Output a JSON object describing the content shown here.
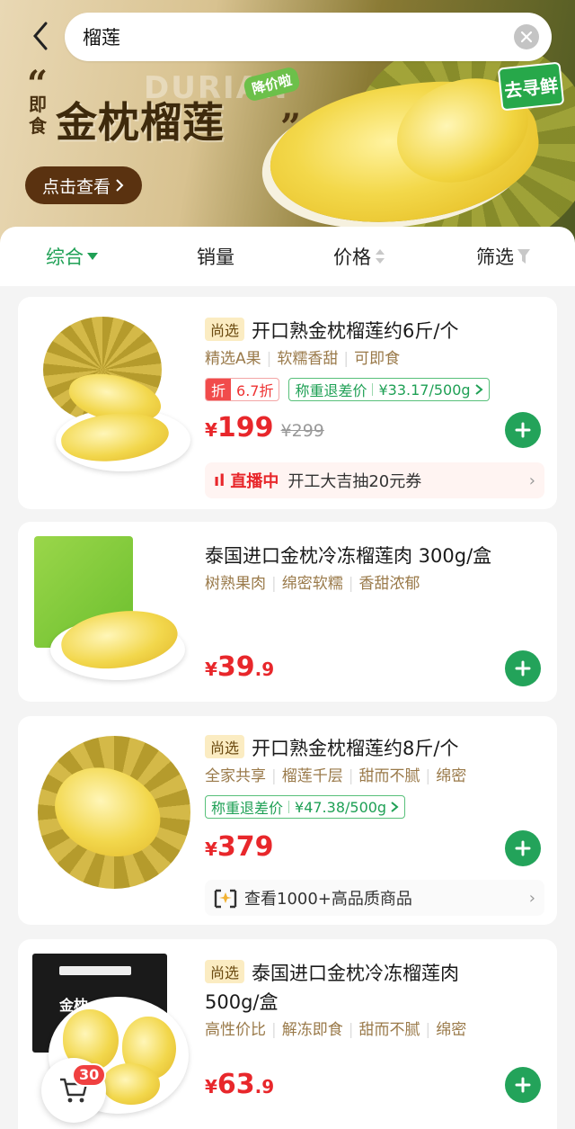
{
  "search": {
    "query": "榴莲"
  },
  "banner": {
    "quote_open": "“",
    "quote_close": "”",
    "tag_vertical": "即食",
    "title": "金枕榴莲",
    "ghost_text": "DURIAN",
    "price_tag": "降价啦",
    "view_button": "点击查看",
    "logo_text": "去寻鲜"
  },
  "tabs": [
    {
      "label": "综合"
    },
    {
      "label": "销量"
    },
    {
      "label": "价格"
    },
    {
      "label": "筛选"
    }
  ],
  "products": [
    {
      "badge": "尚选",
      "title": "开口熟金枕榴莲约6斤/个",
      "features": [
        "精选A果",
        "软糯香甜",
        "可即食"
      ],
      "discount_label": "折",
      "discount_rate": "6.7折",
      "refund_label": "称重退差价",
      "refund_price": "¥33.17/500g",
      "price_currency": "¥",
      "price_int": "199",
      "price_dec": "",
      "price_orig": "¥299",
      "live_label": "直播中",
      "live_text": "开工大吉抽20元券"
    },
    {
      "title": "泰国进口金枕冷冻榴莲肉 300g/盒",
      "features": [
        "树熟果肉",
        "绵密软糯",
        "香甜浓郁"
      ],
      "price_currency": "¥",
      "price_int": "39",
      "price_dec": ".9"
    },
    {
      "badge": "尚选",
      "title": "开口熟金枕榴莲约8斤/个",
      "features": [
        "全家共享",
        "榴莲千层",
        "甜而不腻",
        "绵密"
      ],
      "refund_label": "称重退差价",
      "refund_price": "¥47.38/500g",
      "price_currency": "¥",
      "price_int": "379",
      "price_dec": "",
      "more_text": "查看1000+高品质商品"
    },
    {
      "badge": "尚选",
      "title_line1": "泰国进口金枕冷冻榴莲肉",
      "title_line2": "500g/盒",
      "features": [
        "高性价比",
        "解冻即食",
        "甜而不腻",
        "绵密"
      ],
      "price_currency": "¥",
      "price_int": "63",
      "price_dec": ".9",
      "box_text": "金枕"
    }
  ],
  "cart": {
    "count": "30"
  },
  "colors": {
    "accent_green": "#1fa055",
    "price_red": "#e8272b",
    "badge_bg": "#fbecc2"
  },
  "icons": [
    "back-arrow-icon",
    "clear-icon",
    "caret-down-icon",
    "sort-icon",
    "filter-icon",
    "chevron-right-icon",
    "plus-icon",
    "live-icon",
    "cart-icon",
    "store-icon"
  ]
}
